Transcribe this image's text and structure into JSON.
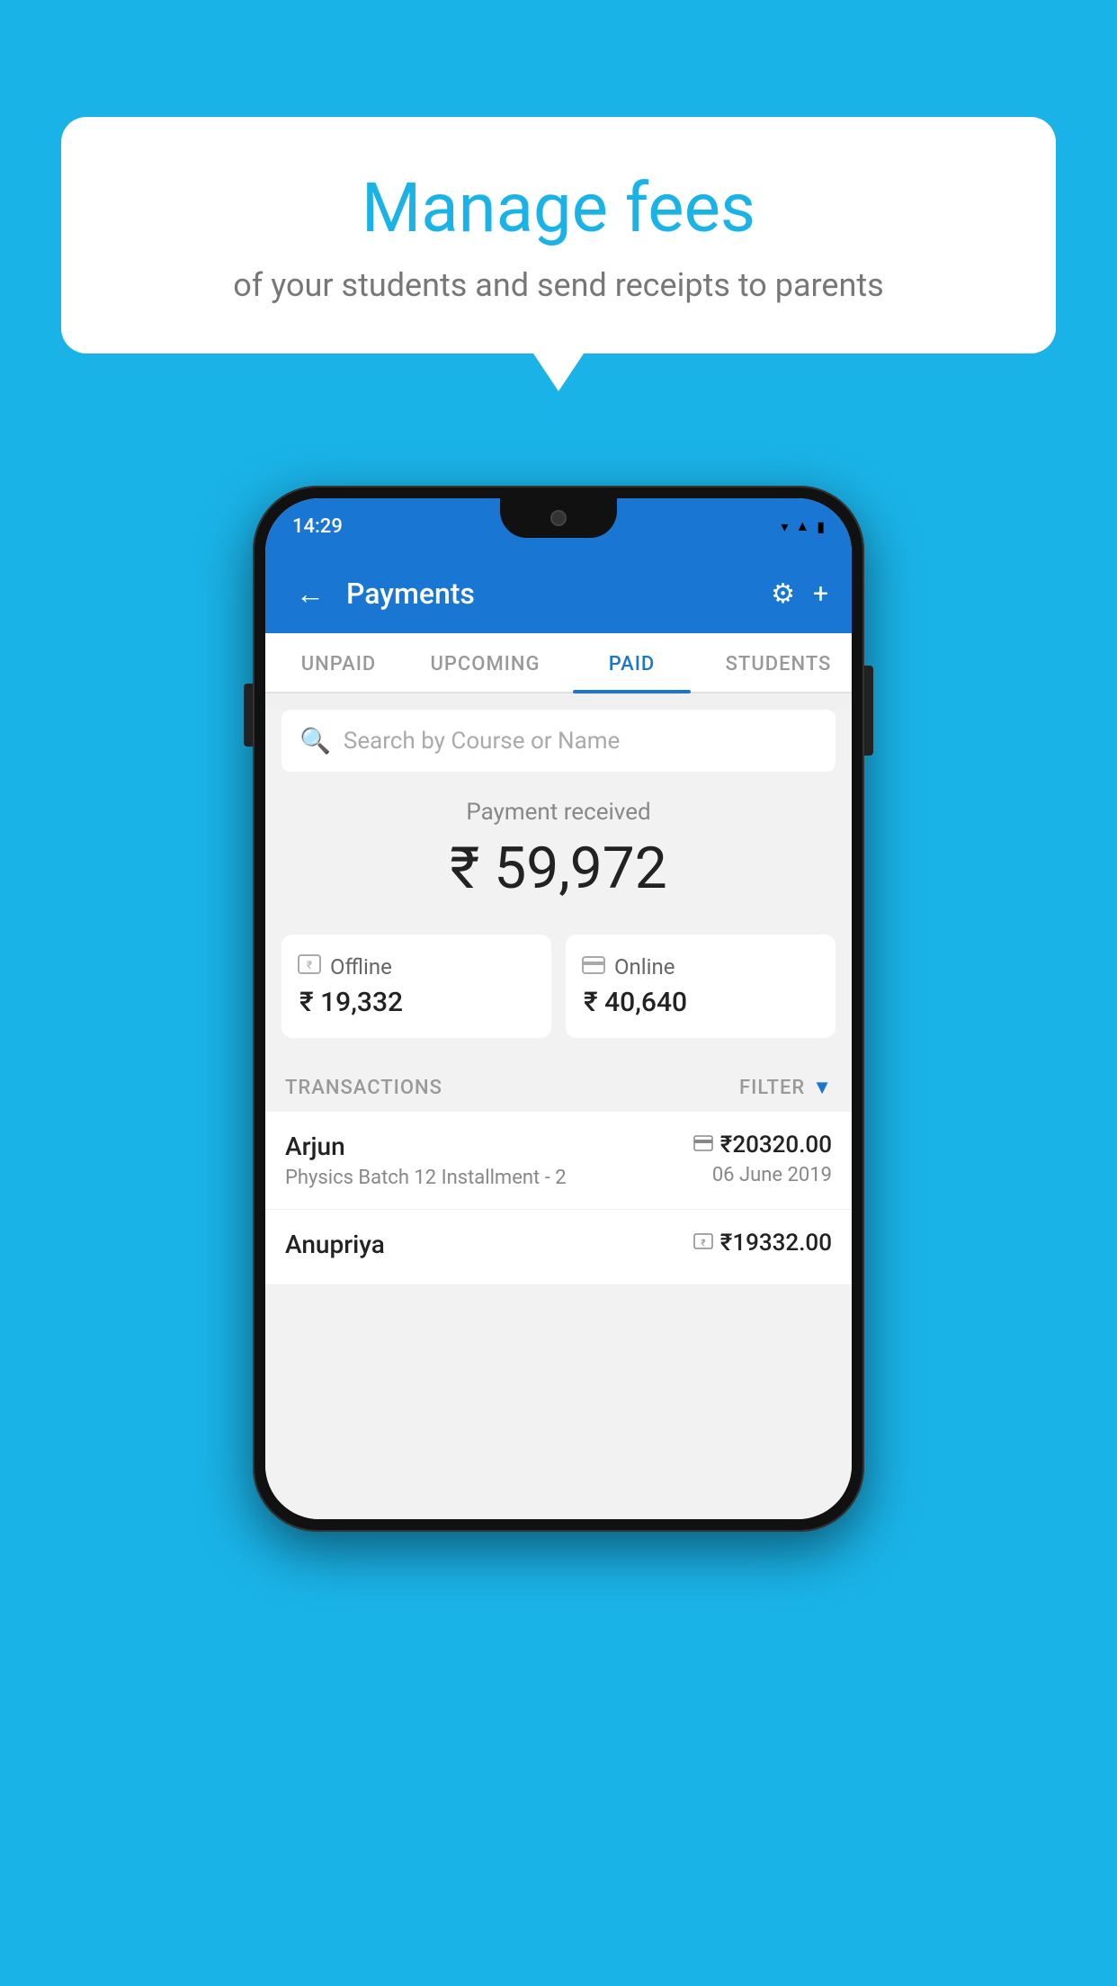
{
  "background_color": "#1ab3e8",
  "speech_bubble": {
    "title": "Manage fees",
    "subtitle": "of your students and send receipts to parents"
  },
  "status_bar": {
    "time": "14:29",
    "icons": [
      "wifi",
      "signal",
      "battery"
    ]
  },
  "app_bar": {
    "title": "Payments",
    "back_icon": "←",
    "settings_icon": "⚙",
    "add_icon": "+"
  },
  "tabs": [
    {
      "label": "UNPAID",
      "active": false
    },
    {
      "label": "UPCOMING",
      "active": false
    },
    {
      "label": "PAID",
      "active": true
    },
    {
      "label": "STUDENTS",
      "active": false
    }
  ],
  "search": {
    "placeholder": "Search by Course or Name"
  },
  "payment_received": {
    "label": "Payment received",
    "amount": "₹ 59,972"
  },
  "payment_modes": [
    {
      "label": "Offline",
      "amount": "₹ 19,332",
      "icon": "rupee-card"
    },
    {
      "label": "Online",
      "amount": "₹ 40,640",
      "icon": "credit-card"
    }
  ],
  "transactions_section": {
    "label": "TRANSACTIONS",
    "filter_label": "FILTER"
  },
  "transactions": [
    {
      "name": "Arjun",
      "detail": "Physics Batch 12 Installment - 2",
      "amount": "₹20320.00",
      "date": "06 June 2019",
      "payment_type": "online"
    },
    {
      "name": "Anupriya",
      "detail": "",
      "amount": "₹19332.00",
      "date": "",
      "payment_type": "offline"
    }
  ]
}
